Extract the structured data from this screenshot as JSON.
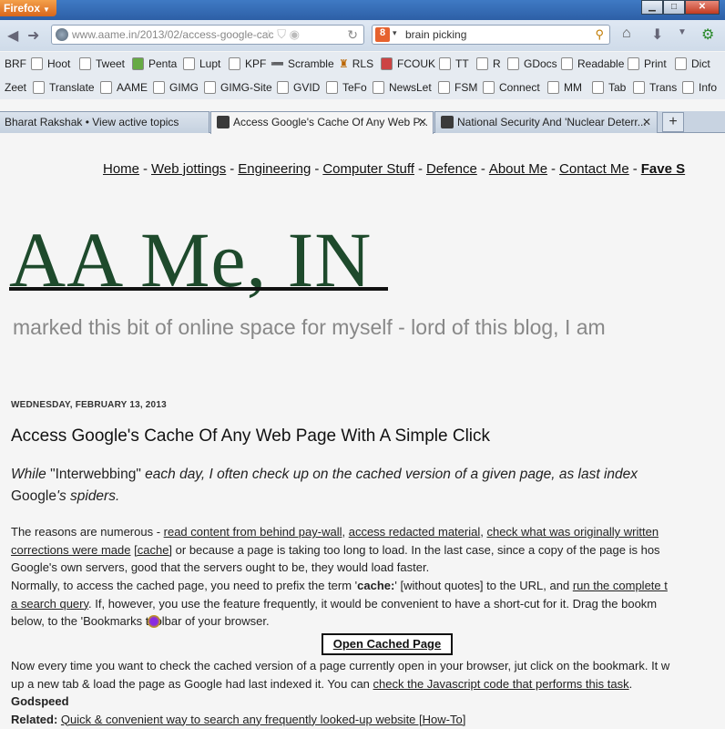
{
  "window": {
    "app_button": "Firefox"
  },
  "toolbar": {
    "url": "www.aame.in/2013/02/access-google-cac",
    "search_query": "brain picking",
    "search_engine": "8"
  },
  "bookmarks_row1": [
    "BRF",
    "Hoot",
    "Tweet",
    "Penta",
    "Lupt",
    "KPF",
    "Scramble",
    "RLS",
    "FCOUK",
    "TT",
    "R",
    "GDocs",
    "Readable",
    "Print",
    "Dict"
  ],
  "bookmarks_row2": [
    "Zeet",
    "Translate",
    "AAME",
    "GIMG",
    "GIMG-Site",
    "GVID",
    "TeFo",
    "NewsLet",
    "FSM",
    "Connect",
    "MM",
    "Tab",
    "Trans",
    "Info"
  ],
  "tabs": [
    {
      "label": "Bharat Rakshak • View active topics"
    },
    {
      "label": "Access Google's Cache Of Any Web P..."
    },
    {
      "label": "National Security And 'Nuclear Deterr..."
    }
  ],
  "nav": [
    "Home",
    "Web jottings",
    "Engineering",
    "Computer Stuff",
    "Defence",
    "About Me",
    "Contact Me",
    "Fave S"
  ],
  "blog": {
    "title": "AA Me, IN",
    "tagline": "marked this bit of online space for myself - lord of this blog, I am"
  },
  "post": {
    "date": "WEDNESDAY, FEBRUARY 13, 2013",
    "title": "Access Google's Cache Of Any Web Page With A Simple Click",
    "intro_1a": "While ",
    "intro_1b": "\"Interwebbing\"",
    "intro_1c": " each day, I often check up on the cached version of a given page, as last index",
    "intro_2a": "Google",
    "intro_2b": "'s spiders.",
    "p1_1a": "The reasons are numerous - ",
    "p1_1b": "read content from behind pay-wall",
    "p1_1c": ", ",
    "p1_1d": "access redacted material",
    "p1_1e": ", ",
    "p1_1f": "check what was originally written",
    "p1_2a": "corrections were made",
    "p1_2b": " ",
    "p1_2c": "[cache]",
    "p1_2d": " or because a page is taking too long to load. In the last case, since a copy of the page is hos",
    "p1_3": "Google's own servers, good that the servers ought to be, they would load faster.",
    "p2_1a": "Normally, to access the cached page, you need to prefix the term '",
    "p2_1b": "cache:",
    "p2_1c": "' [without quotes] to the URL, and ",
    "p2_1d": "run the complete t",
    "p2_2a": "a search query",
    "p2_2b": ". If, however, you use the feature frequently, it would be convenient to have a short-cut for it. Drag the bookm",
    "p2_3": "below, to the 'Bookmarks toolbar of your browser.",
    "button": "Open Cached Page",
    "p3_1": "Now every time you want to check the cached version of a page currently open in your browser, jut click on the bookmark. It w",
    "p3_2a": "up a new tab & load the page as Google had last indexed it. You can ",
    "p3_2b": "check the Javascript code that performs this task",
    "p3_2c": ".",
    "godspeed": "Godspeed",
    "related_label": "Related:",
    "related_link": "Quick & convenient way to search any frequently looked-up website [How-To]"
  }
}
